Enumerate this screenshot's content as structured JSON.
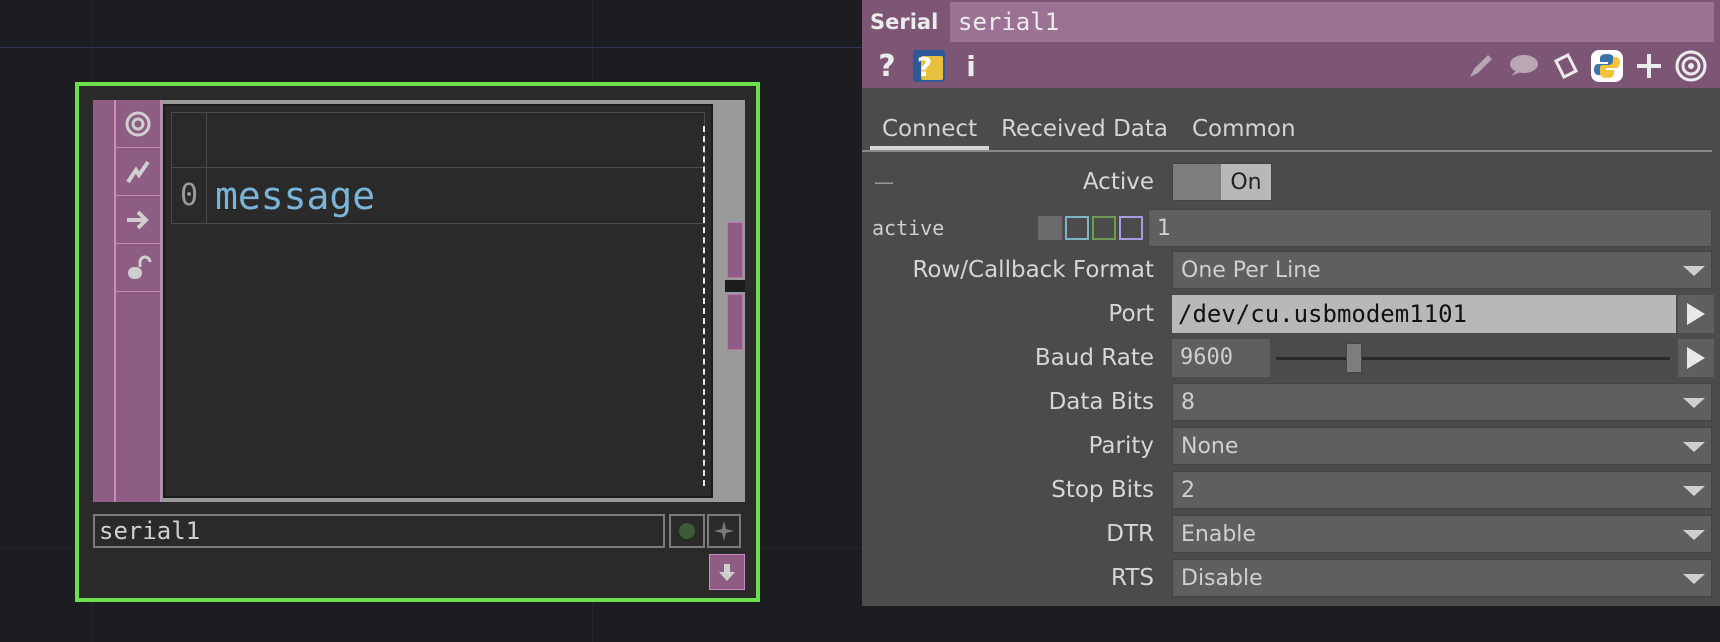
{
  "node": {
    "table": {
      "rows": [
        {
          "index": "0",
          "value": "message"
        }
      ]
    },
    "name": "serial1",
    "icons": [
      "viewer-icon",
      "cook-icon",
      "export-icon",
      "lock-icon"
    ]
  },
  "panel": {
    "type_label": "Serial",
    "name": "serial1",
    "toolbar_icons": [
      "help-icon",
      "operator-snippets-icon",
      "info-icon",
      "edit-icon",
      "comment-icon",
      "clipboard-icon",
      "python-icon",
      "add-icon",
      "viewer-icon"
    ],
    "tabs": [
      {
        "label": "Connect",
        "active": true
      },
      {
        "label": "Received Data",
        "active": false
      },
      {
        "label": "Common",
        "active": false
      }
    ],
    "params": {
      "active": {
        "dash": "—",
        "label": "Active",
        "value": "On"
      },
      "active_channel": {
        "name": "active",
        "value": "1"
      },
      "row_format": {
        "label": "Row/Callback Format",
        "value": "One Per Line"
      },
      "port": {
        "label": "Port",
        "value": "/dev/cu.usbmodem1101"
      },
      "baud": {
        "label": "Baud Rate",
        "value": "9600"
      },
      "data_bits": {
        "label": "Data Bits",
        "value": "8"
      },
      "parity": {
        "label": "Parity",
        "value": "None"
      },
      "stop_bits": {
        "label": "Stop Bits",
        "value": "2"
      },
      "dtr": {
        "label": "DTR",
        "value": "Enable"
      },
      "rts": {
        "label": "RTS",
        "value": "Disable"
      }
    }
  },
  "colors": {
    "node_border": "#6be04a",
    "dat_accent": "#8d5d84",
    "text_cell": "#7ab4d6"
  }
}
